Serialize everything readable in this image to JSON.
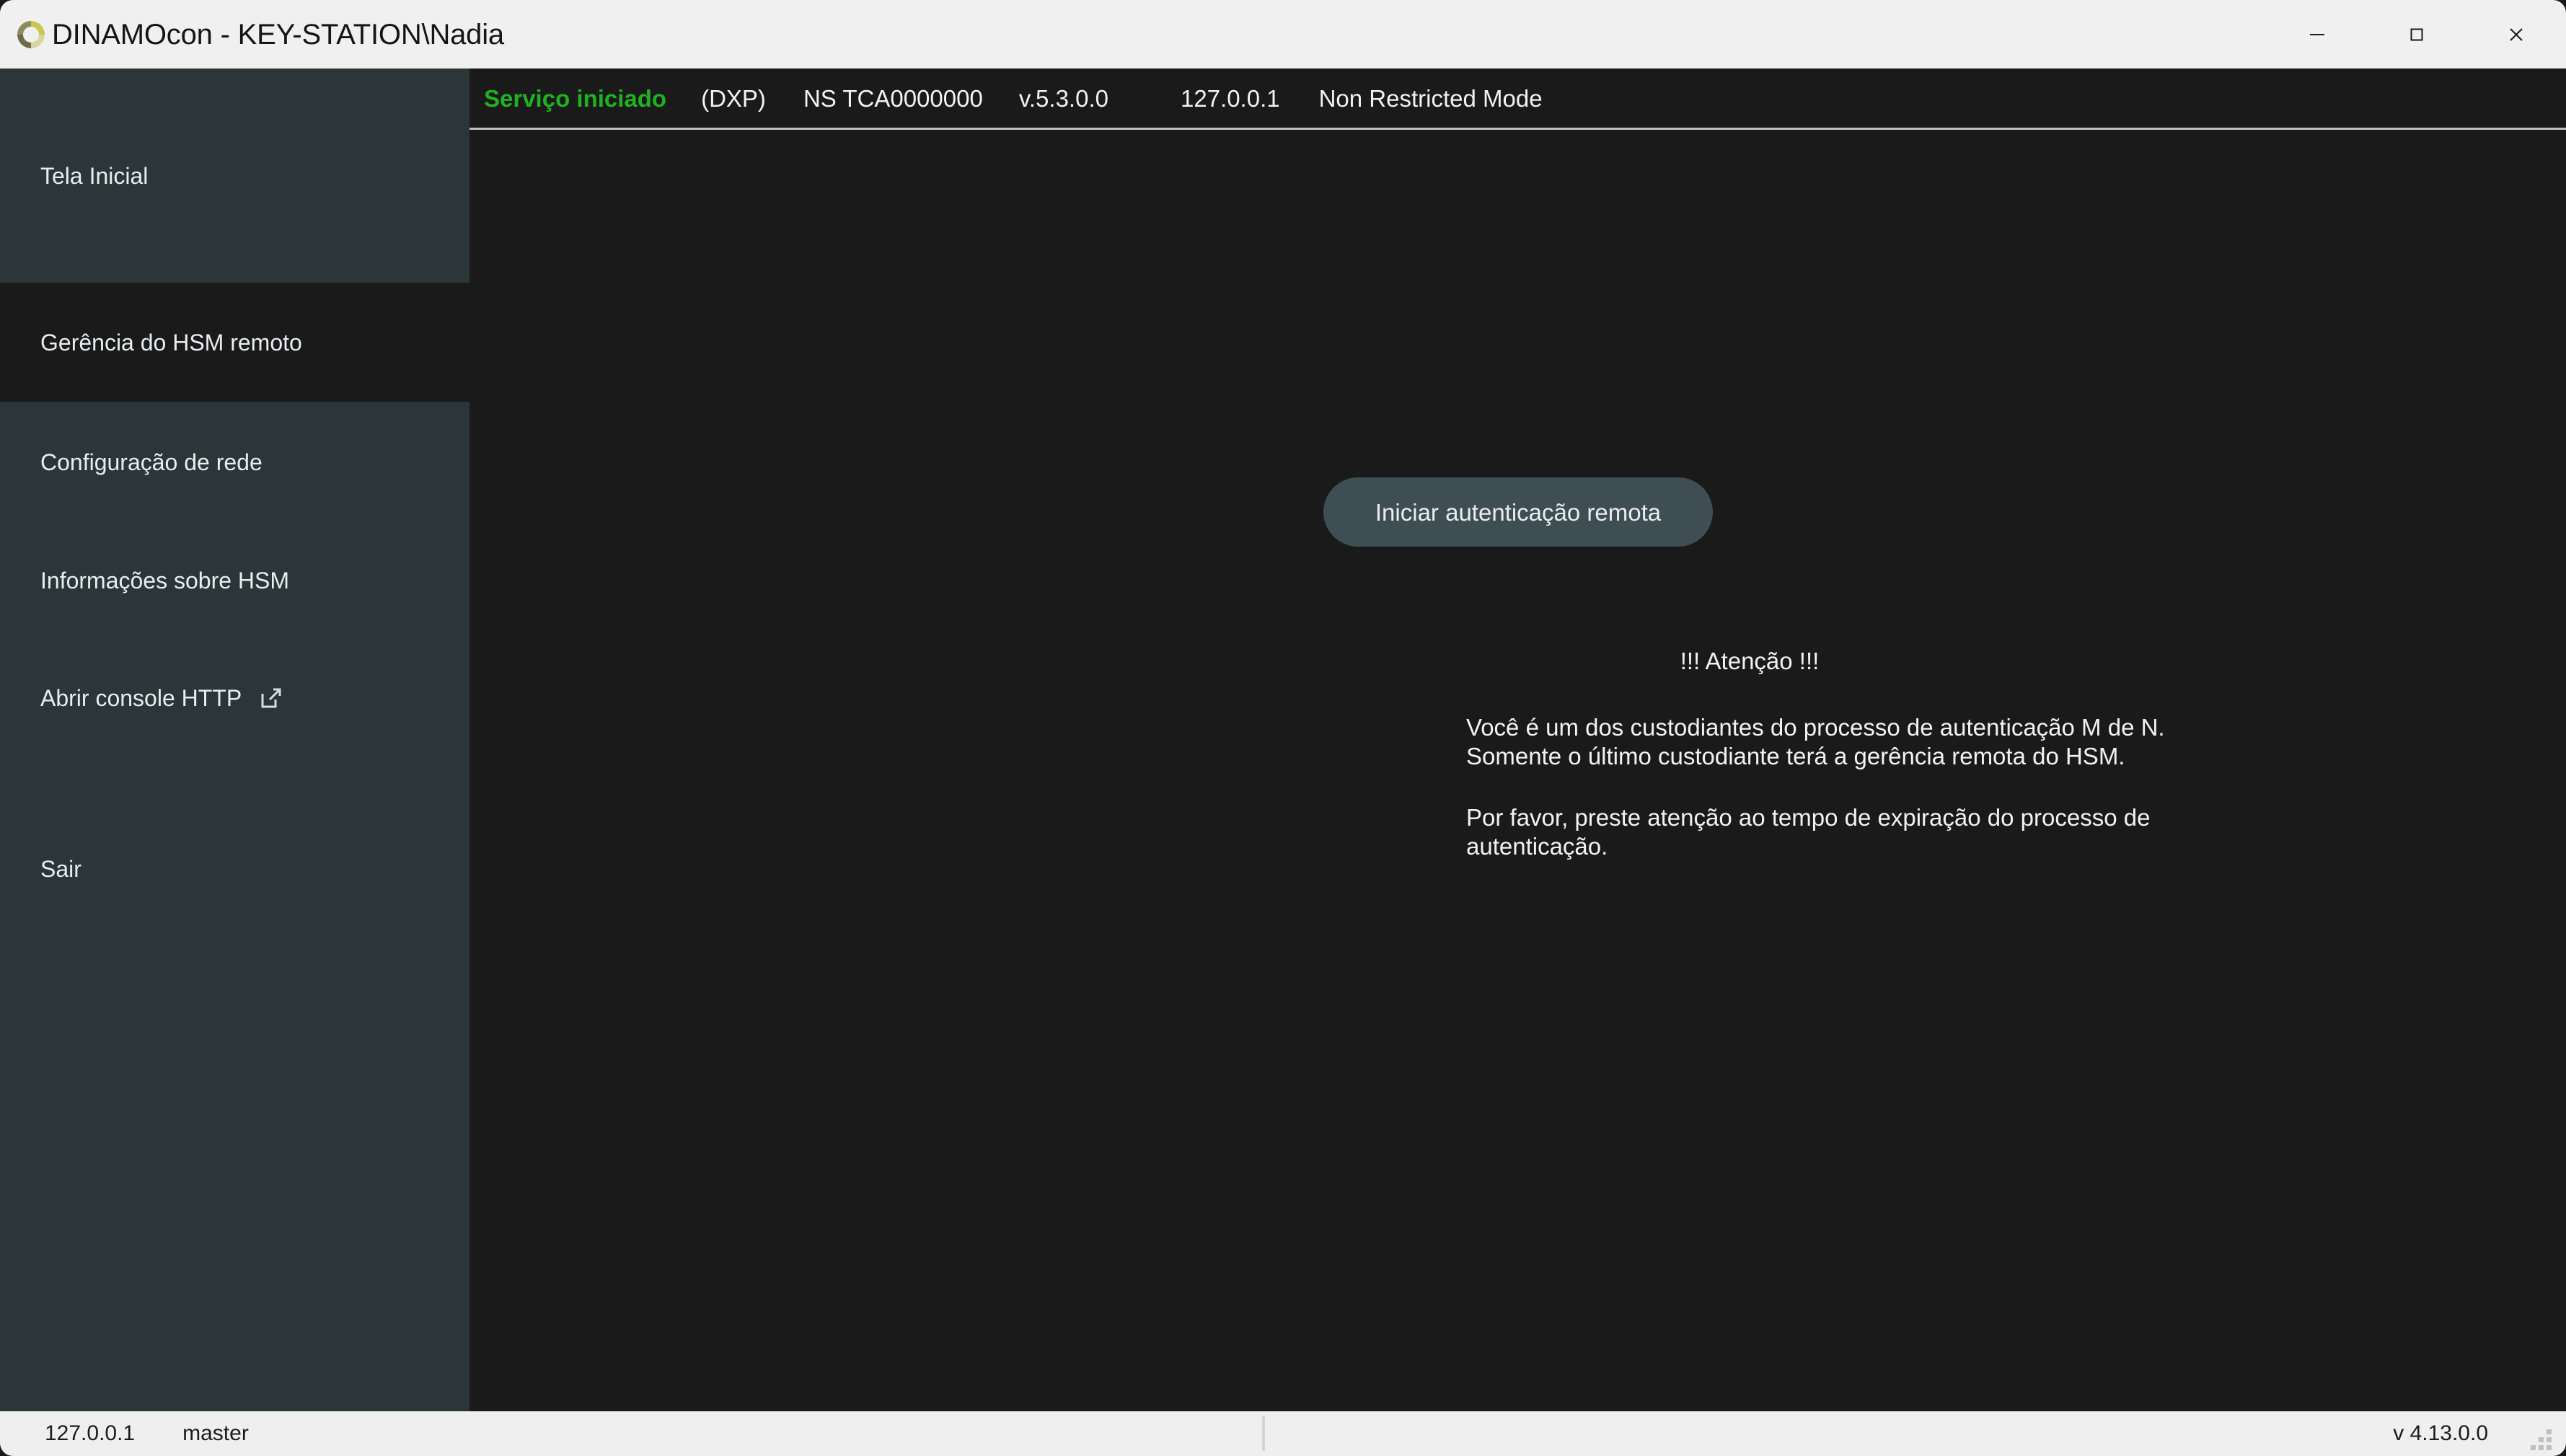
{
  "window": {
    "title": "DINAMOcon - KEY-STATION\\Nadia",
    "logo_icon": "dinamo-ring-logo-icon",
    "controls": {
      "minimize": "minimize-icon",
      "maximize": "maximize-icon",
      "close": "close-icon"
    }
  },
  "colors": {
    "titlebar_bg": "#f0f0f0",
    "sidebar_bg": "#2b3638",
    "sidebar_selected_bg": "#1a1a1a",
    "content_bg": "#1a1a1a",
    "service_status_green": "#22b022",
    "button_bg": "#3f4e52",
    "text_primary": "#f2f2f2",
    "bottombar_bg": "#efefef",
    "logo_olive": "#6d6b4a",
    "logo_yellow": "#c9c84f"
  },
  "sidebar": {
    "items": [
      {
        "id": "tela-inicial",
        "label": "Tela Inicial",
        "selected": false
      },
      {
        "id": "gerencia-remoto",
        "label": "Gerência do HSM remoto",
        "selected": true
      },
      {
        "id": "config-rede",
        "label": "Configuração de rede",
        "selected": false
      },
      {
        "id": "info-hsm",
        "label": "Informações sobre HSM",
        "selected": false
      },
      {
        "id": "console-http",
        "label": "Abrir console HTTP",
        "selected": false,
        "icon": "external-link-icon"
      },
      {
        "id": "sair",
        "label": "Sair",
        "selected": false
      }
    ]
  },
  "status_strip": {
    "service_state": "Serviço iniciado",
    "protocol": "(DXP)",
    "serial": "NS TCA0000000",
    "firmware_version": "v.5.3.0.0",
    "address": "127.0.0.1",
    "mode": "Non Restricted Mode"
  },
  "main": {
    "action_button": "Iniciar autenticação remota",
    "notice": {
      "title": "!!! Atenção !!!",
      "paragraph_1_line_1": "Você é um dos custodiantes do processo de autenticação M de N.",
      "paragraph_1_line_2": "Somente o último custodiante terá a gerência remota do HSM.",
      "paragraph_2_line_1": "Por favor, preste atenção ao tempo de expiração do processo de",
      "paragraph_2_line_2": "autenticação."
    }
  },
  "bottom_bar": {
    "address": "127.0.0.1",
    "session": "master",
    "app_version": "v 4.13.0.0",
    "grip_icon": "resize-grip-icon"
  }
}
